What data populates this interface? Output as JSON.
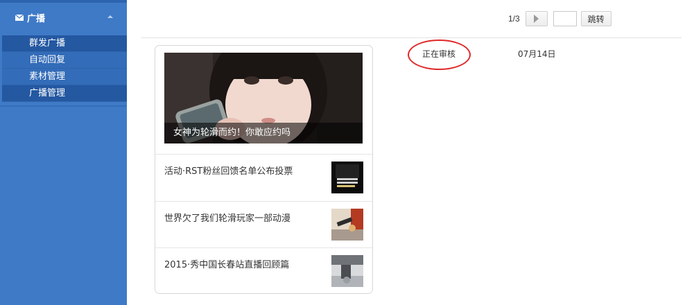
{
  "sidebar": {
    "header_label": "广播",
    "items": [
      {
        "label": "群发广播"
      },
      {
        "label": "自动回复"
      },
      {
        "label": "素材管理"
      },
      {
        "label": "广播管理"
      }
    ]
  },
  "pager": {
    "count": "1/3",
    "jump_label": "跳转",
    "page_input_value": ""
  },
  "card": {
    "cover_title": "女神为轮滑而约！你敢应约吗",
    "articles": [
      {
        "title": "活动·RST粉丝回馈名单公布投票"
      },
      {
        "title": "世界欠了我们轮滑玩家一部动漫"
      },
      {
        "title": "2015·秀中国长春站直播回顾篇"
      }
    ]
  },
  "status_text": "正在审核",
  "date_text": "07月14日",
  "colors": {
    "sidebar_bg": "#3f7ac7",
    "active_item_bg": "#2458a1",
    "highlight_ring": "#e02828"
  }
}
